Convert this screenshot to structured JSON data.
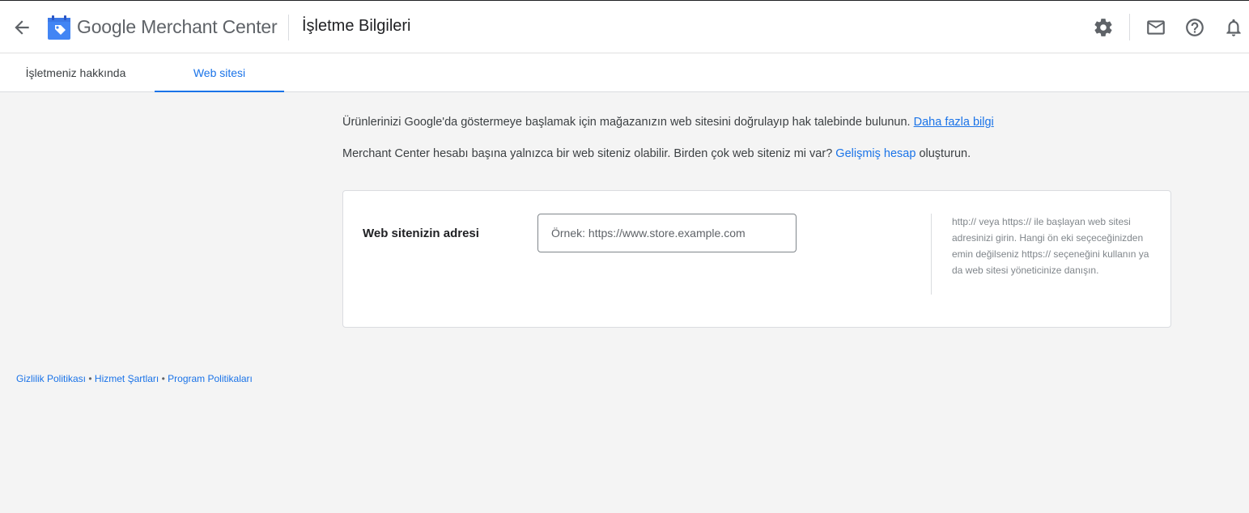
{
  "header": {
    "brand_google": "Google",
    "brand_product": "Merchant Center",
    "page_title": "İşletme Bilgileri",
    "icons": [
      "back-arrow-icon",
      "merchant-center-logo-icon",
      "settings-gear-icon",
      "mail-icon",
      "help-icon",
      "notifications-bell-icon"
    ]
  },
  "tabs": [
    {
      "label": "İşletmeniz hakkında",
      "active": false
    },
    {
      "label": "Web sitesi",
      "active": true
    }
  ],
  "intro": {
    "line1_text": "Ürünlerinizi Google'da göstermeye başlamak için mağazanızın web sitesini doğrulayıp hak talebinde bulunun.",
    "line1_link": "Daha fazla bilgi",
    "line2_before": "Merchant Center hesabı başına yalnızca bir web siteniz olabilir. Birden çok web siteniz mi var?",
    "line2_link": "Gelişmiş hesap",
    "line2_after": "oluşturun."
  },
  "website_form": {
    "label": "Web sitenizin adresi",
    "value": "",
    "placeholder": "Örnek: https://www.store.example.com",
    "help_text": "http:// veya https:// ile başlayan web sitesi adresinizi girin. Hangi ön eki seçeceğinizden emin değilseniz https:// seçeneğini kullanın ya da web sitesi yöneticinize danışın."
  },
  "footer": {
    "privacy": "Gizlilik Politikası",
    "terms": "Hizmet Şartları",
    "policies": "Program Politikaları",
    "separator": "•"
  },
  "colors": {
    "accent": "#1a73e8",
    "background": "#f4f4f4",
    "surface": "#ffffff",
    "text": "#3c4043",
    "muted": "#80868b"
  }
}
